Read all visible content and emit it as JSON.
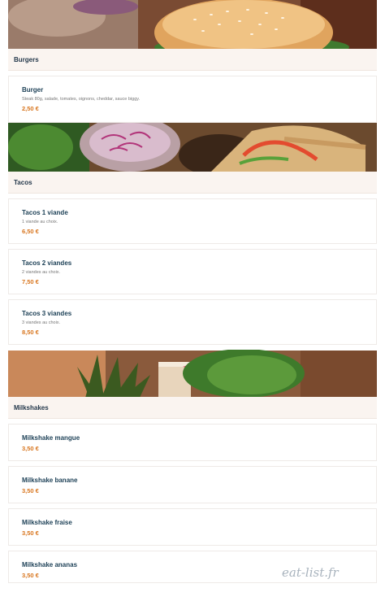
{
  "sections": [
    {
      "title": "Burgers",
      "items": [
        {
          "name": "Burger",
          "description": "Steak 80g, salade, tomates, oignons, cheddar, sauce biggy.",
          "price": "2,50 €"
        }
      ]
    },
    {
      "title": "Tacos",
      "items": [
        {
          "name": "Tacos 1 viande",
          "description": "1 viande au choix.",
          "price": "6,50 €"
        },
        {
          "name": "Tacos 2 viandes",
          "description": "2 viandes au choix.",
          "price": "7,50 €"
        },
        {
          "name": "Tacos 3 viandes",
          "description": "3 viandes au choix.",
          "price": "8,50 €"
        }
      ]
    },
    {
      "title": "Milkshakes",
      "items": [
        {
          "name": "Milkshake mangue",
          "price": "3,50 €"
        },
        {
          "name": "Milkshake banane",
          "price": "3,50 €"
        },
        {
          "name": "Milkshake fraise",
          "price": "3,50 €"
        },
        {
          "name": "Milkshake ananas",
          "price": "3,50 €"
        }
      ]
    }
  ],
  "watermark": "eat-list.fr",
  "colors": {
    "header_bg": "#faf4f0",
    "item_name": "#1f4258",
    "price": "#d8761f"
  }
}
